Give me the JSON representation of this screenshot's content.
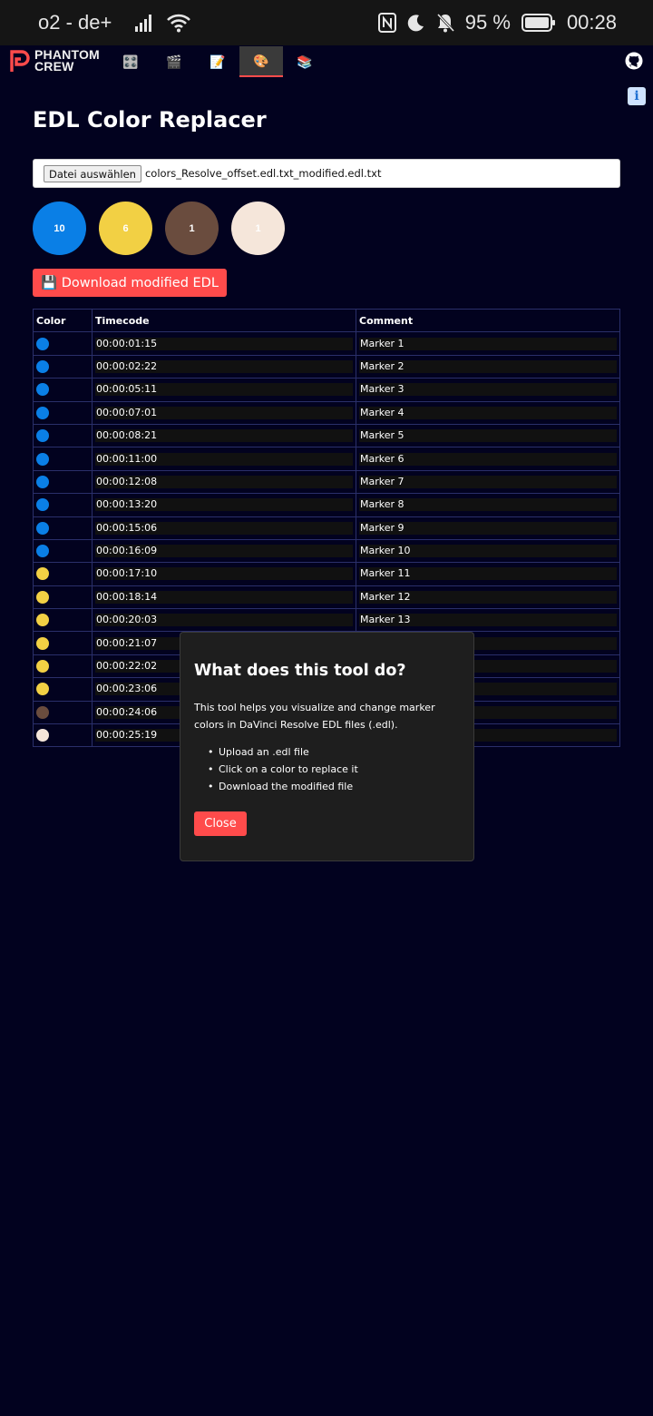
{
  "status_bar": {
    "carrier": "o2 - de+",
    "battery_percent": "95 %",
    "time": "00:28"
  },
  "nav": {
    "logo_line1": "PHANTOM",
    "logo_line2": "CREW",
    "tabs": [
      {
        "icon": "🎛️",
        "name": "tab-controls"
      },
      {
        "icon": "🎬",
        "name": "tab-clapper"
      },
      {
        "icon": "📝",
        "name": "tab-notes"
      },
      {
        "icon": "🎨",
        "name": "tab-palette",
        "active": true
      },
      {
        "icon": "📚",
        "name": "tab-books"
      }
    ]
  },
  "page": {
    "title": "EDL Color Replacer",
    "file_button_label": "Datei auswählen",
    "file_name": "colors_Resolve_offset.edl.txt_modified.edl.txt",
    "download_label": "💾 Download modified EDL",
    "info_icon": "i"
  },
  "swatches": [
    {
      "count": "10",
      "color": "#0a7fe6"
    },
    {
      "count": "6",
      "color": "#f2d044"
    },
    {
      "count": "1",
      "color": "#6a4c3e"
    },
    {
      "count": "1",
      "color": "#f5e6da"
    }
  ],
  "table": {
    "headers": [
      "Color",
      "Timecode",
      "Comment"
    ],
    "rows": [
      {
        "color": "#0a7fe6",
        "timecode": "00:00:01:15",
        "comment": "Marker 1"
      },
      {
        "color": "#0a7fe6",
        "timecode": "00:00:02:22",
        "comment": "Marker 2"
      },
      {
        "color": "#0a7fe6",
        "timecode": "00:00:05:11",
        "comment": "Marker 3"
      },
      {
        "color": "#0a7fe6",
        "timecode": "00:00:07:01",
        "comment": "Marker 4"
      },
      {
        "color": "#0a7fe6",
        "timecode": "00:00:08:21",
        "comment": "Marker 5"
      },
      {
        "color": "#0a7fe6",
        "timecode": "00:00:11:00",
        "comment": "Marker 6"
      },
      {
        "color": "#0a7fe6",
        "timecode": "00:00:12:08",
        "comment": "Marker 7"
      },
      {
        "color": "#0a7fe6",
        "timecode": "00:00:13:20",
        "comment": "Marker 8"
      },
      {
        "color": "#0a7fe6",
        "timecode": "00:00:15:06",
        "comment": "Marker 9"
      },
      {
        "color": "#0a7fe6",
        "timecode": "00:00:16:09",
        "comment": "Marker 10"
      },
      {
        "color": "#f2d044",
        "timecode": "00:00:17:10",
        "comment": "Marker 11"
      },
      {
        "color": "#f2d044",
        "timecode": "00:00:18:14",
        "comment": "Marker 12"
      },
      {
        "color": "#f2d044",
        "timecode": "00:00:20:03",
        "comment": "Marker 13"
      },
      {
        "color": "#f2d044",
        "timecode": "00:00:21:07",
        "comment": ""
      },
      {
        "color": "#f2d044",
        "timecode": "00:00:22:02",
        "comment": ""
      },
      {
        "color": "#f2d044",
        "timecode": "00:00:23:06",
        "comment": ""
      },
      {
        "color": "#6a4c3e",
        "timecode": "00:00:24:06",
        "comment": ""
      },
      {
        "color": "#f5e6da",
        "timecode": "00:00:25:19",
        "comment": ""
      }
    ]
  },
  "modal": {
    "title": "What does this tool do?",
    "description": "This tool helps you visualize and change marker colors in DaVinci Resolve EDL files (.edl).",
    "steps": [
      "Upload an .edl file",
      "Click on a color to replace it",
      "Download the modified file"
    ],
    "close_label": "Close"
  },
  "colors": {
    "background": "#02021f",
    "accent": "#ff4b4b",
    "modal_bg": "#1e1e1e"
  }
}
